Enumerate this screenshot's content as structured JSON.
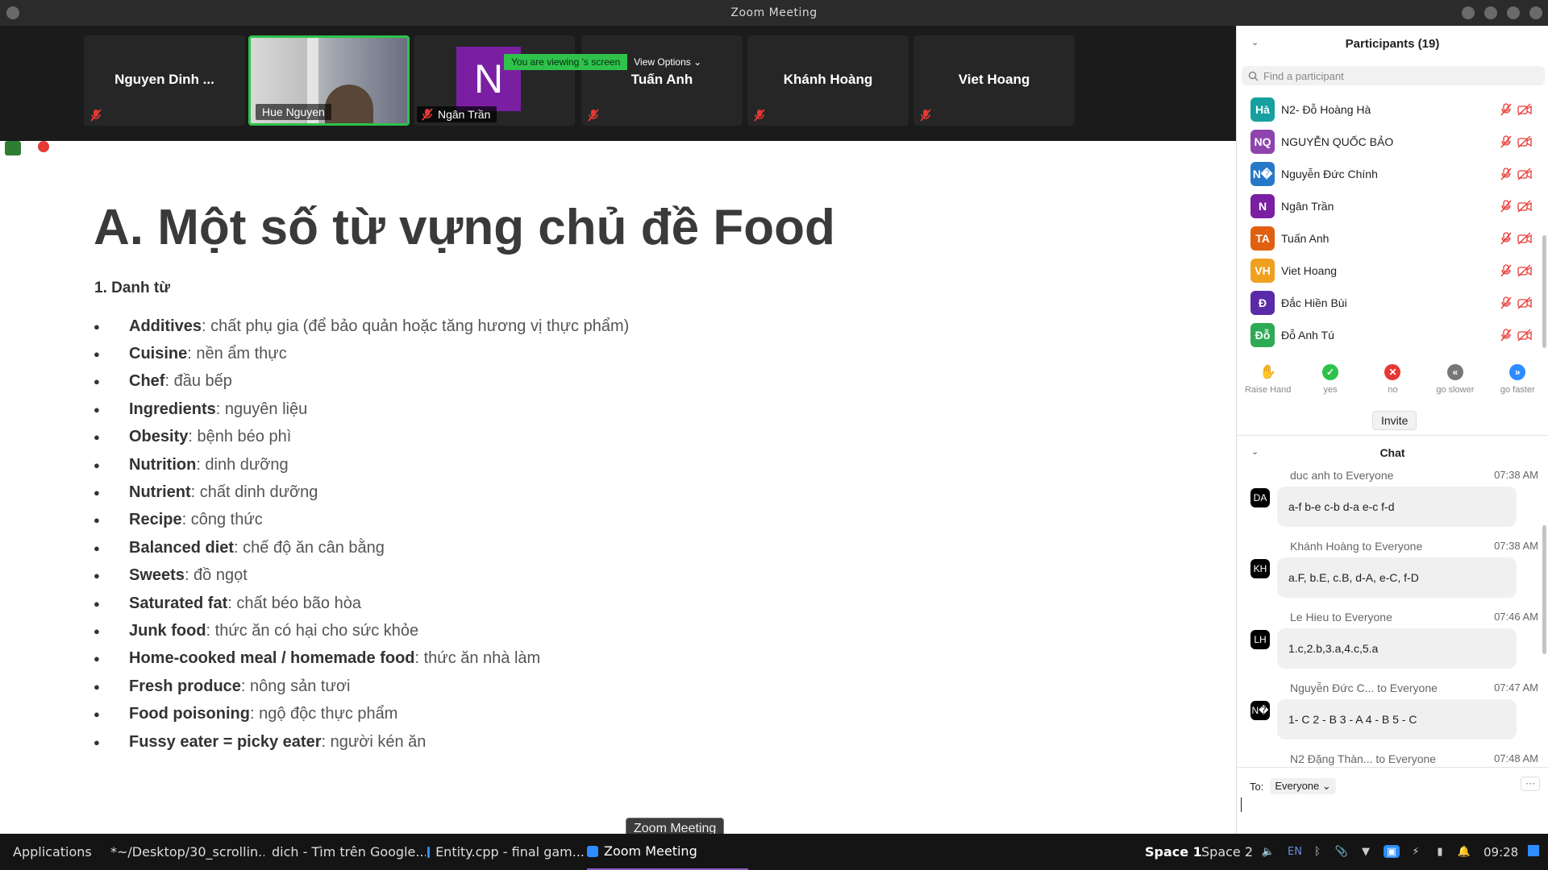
{
  "window": {
    "title": "Zoom Meeting"
  },
  "gallery": {
    "viewing_banner": "You are viewing 's screen",
    "view_options": "View Options",
    "tiles": [
      {
        "name": "Nguyen Dinh ..."
      },
      {
        "name": "Hue Nguyen"
      },
      {
        "name": "Ngân Trần",
        "initial": "N"
      },
      {
        "name": "Tuấn Anh"
      },
      {
        "name": "Khánh Hoàng"
      },
      {
        "name": "Viet Hoang"
      }
    ]
  },
  "slide": {
    "title": "A. Một số từ vựng chủ đề Food",
    "section": "1. Danh từ",
    "items": [
      {
        "term": "Additives",
        "meaning": ": chất phụ gia (để bảo quản hoặc tăng hương vị thực phẩm)"
      },
      {
        "term": "Cuisine",
        "meaning": ": nền ẩm thực"
      },
      {
        "term": "Chef",
        "meaning": ": đầu bếp"
      },
      {
        "term": "Ingredients",
        "meaning": ": nguyên liệu"
      },
      {
        "term": "Obesity",
        "meaning": ": bệnh béo phì"
      },
      {
        "term": "Nutrition",
        "meaning": ": dinh dưỡng"
      },
      {
        "term": "Nutrient",
        "meaning": ": chất dinh dưỡng"
      },
      {
        "term": "Recipe",
        "meaning": ": công thức"
      },
      {
        "term": "Balanced diet",
        "meaning": ": chế độ ăn cân bằng"
      },
      {
        "term": "Sweets",
        "meaning": ": đồ ngọt"
      },
      {
        "term": "Saturated fat",
        "meaning": ": chất béo bão hòa"
      },
      {
        "term": "Junk food",
        "meaning": ": thức ăn có hại cho sức khỏe"
      },
      {
        "term": "Home-cooked meal / homemade food",
        "meaning": ": thức ăn nhà làm"
      },
      {
        "term": "Fresh produce",
        "meaning": ": nông sản tươi"
      },
      {
        "term": "Food poisoning",
        "meaning": ": ngộ độc thực phẩm"
      },
      {
        "term": "Fussy eater = picky eater",
        "meaning": ": người kén ăn"
      }
    ],
    "tooltip": "Zoom Meeting"
  },
  "participants": {
    "title": "Participants (19)",
    "search_placeholder": "Find a participant",
    "list": [
      {
        "initials": "Hà",
        "name": "N2- Đỗ Hoàng Hà",
        "color": "#16a0a0"
      },
      {
        "initials": "NQ",
        "name": "NGUYỄN QUỐC BẢO",
        "color": "#8e44ad"
      },
      {
        "initials": "N�",
        "name": "Nguyễn Đức Chính",
        "color": "#2878c8"
      },
      {
        "initials": "N",
        "name": "Ngân Trần",
        "color": "#7a1fa2"
      },
      {
        "initials": "TA",
        "name": "Tuấn Anh",
        "color": "#e06010"
      },
      {
        "initials": "VH",
        "name": "Viet Hoang",
        "color": "#f0a020"
      },
      {
        "initials": "Đ",
        "name": "Đắc Hiền Bùi",
        "color": "#5b2aa8"
      },
      {
        "initials": "Đỗ",
        "name": "Đỗ Anh Tú",
        "color": "#2eaa55"
      }
    ],
    "reactions": [
      {
        "label": "Raise Hand",
        "icon": "raise-hand-icon",
        "color": "#2d8cff"
      },
      {
        "label": "yes",
        "icon": "check-icon",
        "color": "#2ec24b"
      },
      {
        "label": "no",
        "icon": "x-icon",
        "color": "#e53935"
      },
      {
        "label": "go slower",
        "icon": "rewind-icon",
        "color": "#777777"
      },
      {
        "label": "go faster",
        "icon": "fast-forward-icon",
        "color": "#2d8cff"
      }
    ],
    "invite_label": "Invite"
  },
  "chat": {
    "title": "Chat",
    "messages": [
      {
        "from": "duc anh to Everyone",
        "time": "07:38 AM",
        "avatar": "DA",
        "text": "a-f b-e c-b d-a e-c f-d"
      },
      {
        "from": "Khánh Hoàng to Everyone",
        "time": "07:38 AM",
        "avatar": "KH",
        "text": "a.F, b.E, c.B, d-A, e-C, f-D"
      },
      {
        "from": "Le Hieu to Everyone",
        "time": "07:46 AM",
        "avatar": "LH",
        "text": "1.c,2.b,3.a,4.c,5.a"
      },
      {
        "from": "Nguyễn Đức C... to Everyone",
        "time": "07:47 AM",
        "avatar": "N�",
        "text": "1- C 2 - B 3 - A 4 - B 5 - C"
      },
      {
        "from": "N2 Đặng Thàn... to Everyone",
        "time": "07:48 AM",
        "avatar": "",
        "text": ""
      }
    ],
    "to_label": "To:",
    "to_value": "Everyone",
    "more_label": "···"
  },
  "taskbar": {
    "applications": "Applications",
    "windows": [
      {
        "label": "*~/Desktop/30_scrollin...",
        "icon": "text-editor-icon",
        "color": "#f0c040"
      },
      {
        "label": "dich - Tìm trên Google...",
        "icon": "chrome-icon",
        "color": "#e04030"
      },
      {
        "label": "Entity.cpp - final gam...",
        "icon": "vscode-icon",
        "color": "#2d8cff"
      },
      {
        "label": "Zoom Meeting",
        "icon": "zoom-icon",
        "color": "#2d8cff"
      }
    ],
    "spaces": [
      "Space 1",
      "Space 2"
    ],
    "lang": "EN",
    "clock": "09:28"
  }
}
